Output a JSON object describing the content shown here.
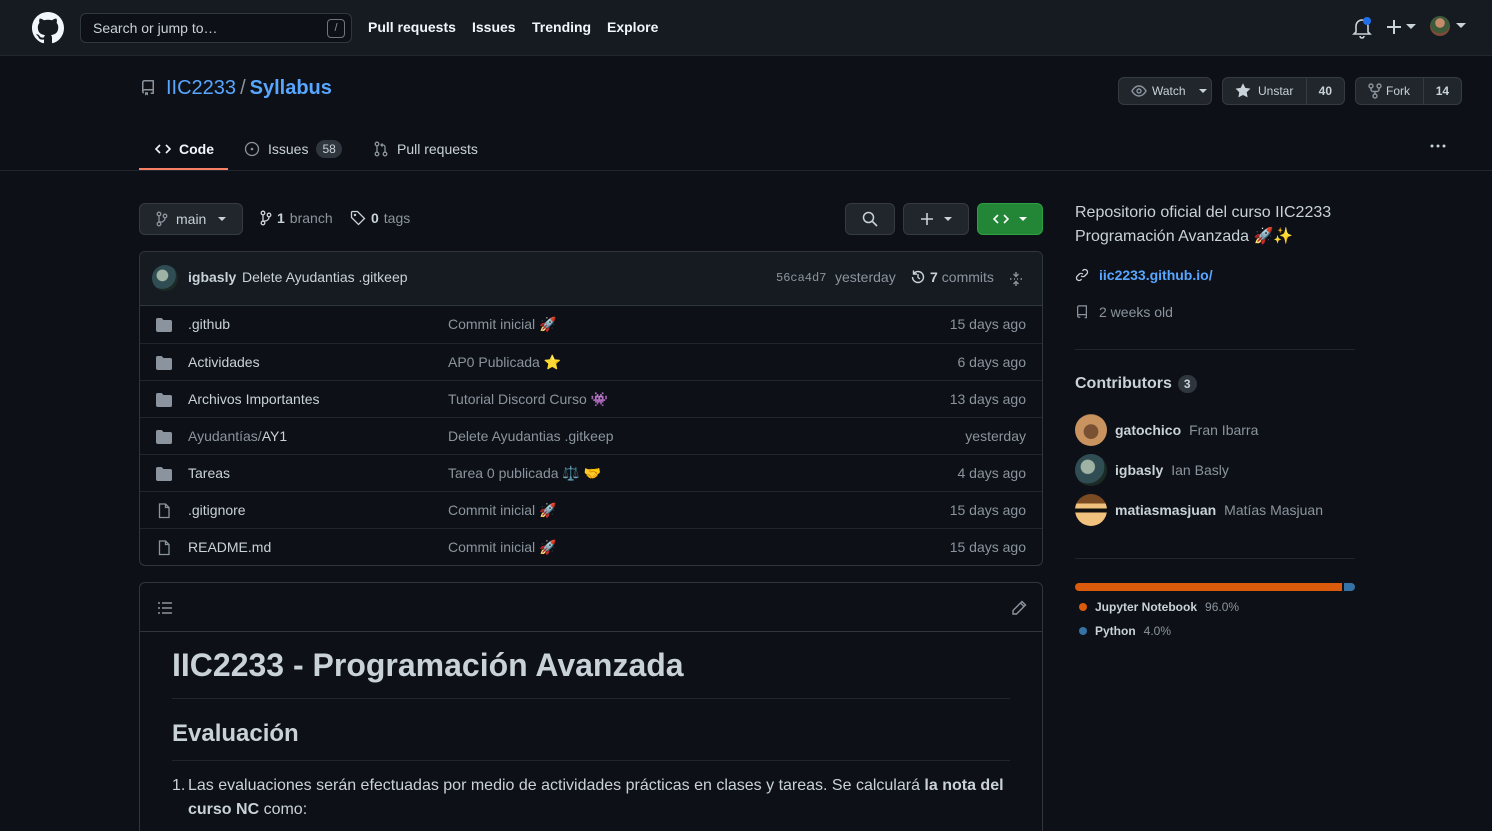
{
  "header": {
    "search_placeholder": "Search or jump to…",
    "search_shortcut": "/",
    "nav": [
      "Pull requests",
      "Issues",
      "Trending",
      "Explore"
    ]
  },
  "repo": {
    "owner": "IIC2233",
    "separator": "/",
    "name": "Syllabus",
    "watch_label": "Watch",
    "star_label": "Unstar",
    "star_count": "40",
    "fork_label": "Fork",
    "fork_count": "14"
  },
  "tabs": {
    "code": "Code",
    "issues": "Issues",
    "issues_count": "58",
    "pulls": "Pull requests"
  },
  "filenav": {
    "branch": "main",
    "branch_count": "1",
    "branch_word": "branch",
    "tag_count": "0",
    "tag_word": "tags"
  },
  "commit": {
    "author": "igbasly",
    "message": "Delete Ayudantias .gitkeep",
    "sha": "56ca4d7",
    "when": "yesterday",
    "commits_count": "7",
    "commits_word": "commits"
  },
  "files": [
    {
      "type": "dir",
      "name": ".github",
      "message": "Commit inicial 🚀",
      "age": "15 days ago"
    },
    {
      "type": "dir",
      "name": "Actividades",
      "message": "AP0 Publicada ⭐",
      "age": "6 days ago"
    },
    {
      "type": "dir",
      "name": "Archivos Importantes",
      "message": "Tutorial Discord Curso 👾",
      "age": "13 days ago"
    },
    {
      "type": "dir",
      "name_prefix": "Ayudantías/",
      "name": "AY1",
      "message": "Delete Ayudantias .gitkeep",
      "age": "yesterday"
    },
    {
      "type": "dir",
      "name": "Tareas",
      "message": "Tarea 0 publicada ⚖️ 🤝",
      "age": "4 days ago"
    },
    {
      "type": "file",
      "name": ".gitignore",
      "message": "Commit inicial 🚀",
      "age": "15 days ago"
    },
    {
      "type": "file",
      "name": "README.md",
      "message": "Commit inicial 🚀",
      "age": "15 days ago"
    }
  ],
  "readme": {
    "title": "IIC2233 - Programación Avanzada",
    "section": "Evaluación",
    "item_number": "1.",
    "item_text": "Las evaluaciones serán efectuadas por medio de actividades prácticas en clases y tareas. Se calculará ",
    "item_bold": "la nota del curso NC",
    "item_tail": " como:"
  },
  "sidebar": {
    "about": "Repositorio oficial del curso IIC2233 Programación Avanzada 🚀✨",
    "website": "iic2233.github.io/",
    "age": "2 weeks old",
    "contributors_title": "Contributors",
    "contributors_count": "3",
    "contributors": [
      {
        "login": "gatochico",
        "name": "Fran Ibarra"
      },
      {
        "login": "igbasly",
        "name": "Ian Basly"
      },
      {
        "login": "matiasmasjuan",
        "name": "Matías Masjuan"
      }
    ],
    "languages": [
      {
        "name": "Jupyter Notebook",
        "percent": "96.0%",
        "value": 96.0,
        "color": "#DA5B0B"
      },
      {
        "name": "Python",
        "percent": "4.0%",
        "value": 4.0,
        "color": "#3572A5"
      }
    ]
  },
  "colors": {
    "accent": "#58a6ff",
    "tab_underline": "#f78166",
    "green_button": "#238636",
    "notification": "#1f6feb"
  }
}
